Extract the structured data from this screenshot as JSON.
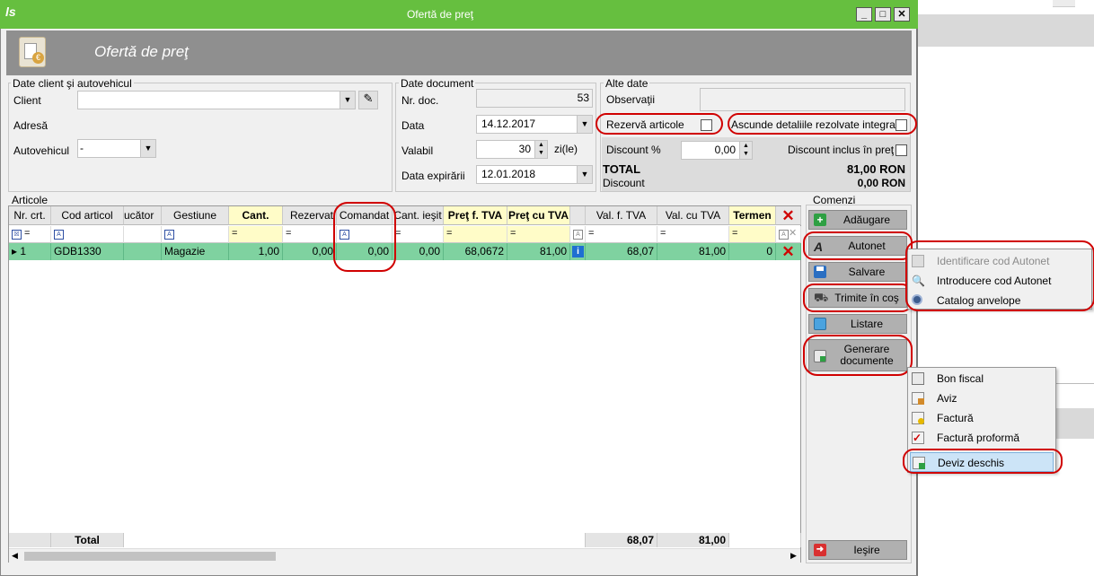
{
  "window": {
    "title": "Ofertă de preţ",
    "header_title": "Ofertă de preţ"
  },
  "client_group": {
    "label": "Date client şi autovehicul",
    "client_label": "Client",
    "client_value": "",
    "address_label": "Adresă",
    "vehicle_label": "Autovehicul",
    "vehicle_value": "-"
  },
  "doc_group": {
    "label": "Date document",
    "nr_label": "Nr. doc.",
    "nr_value": "53",
    "date_label": "Data",
    "date_value": "14.12.2017",
    "valid_label": "Valabil",
    "valid_value": "30",
    "valid_unit": "zi(le)",
    "expiry_label": "Data expirării",
    "expiry_value": "12.01.2018"
  },
  "other_group": {
    "label": "Alte date",
    "obs_label": "Observaţii",
    "reserve_label": "Rezervă articole",
    "hide_label": "Ascunde detaliile rezolvate integral",
    "discount_label": "Discount %",
    "discount_value": "0,00",
    "discount_incl_label": "Discount inclus în preţ",
    "total_label": "TOTAL",
    "total_value": "81,00 RON",
    "discount_sum_label": "Discount",
    "discount_sum_value": "0,00 RON"
  },
  "articles": {
    "label": "Articole",
    "columns": [
      "Nr. crt.",
      "Cod articol",
      "ucător",
      "Gestiune",
      "Cant.",
      "Rezervat",
      "Comandat",
      "Cant. ieşit",
      "Preţ f. TVA",
      "Preţ cu TVA",
      "Val. f. TVA",
      "Val. cu TVA",
      "Termen"
    ],
    "row": {
      "nr": "1",
      "code": "GDB1330",
      "producer": "",
      "store": "Magazie",
      "qty": "1,00",
      "reserved": "0,00",
      "ordered": "0,00",
      "out": "0,00",
      "price_net": "68,0672",
      "price_gross": "81,00",
      "val_net": "68,07",
      "val_gross": "81,00",
      "term": "0"
    },
    "total_label": "Total",
    "total_net": "68,07",
    "total_gross": "81,00"
  },
  "commands": {
    "label": "Comenzi",
    "add": "Adăugare",
    "autonet": "Autonet",
    "save": "Salvare",
    "send_cart": "Trimite în coş",
    "print": "Listare",
    "generate": "Generare documente",
    "exit": "Ieşire"
  },
  "autonet_menu": [
    "Identificare cod Autonet",
    "Introducere cod Autonet",
    "Catalog anvelope"
  ],
  "generate_menu": [
    "Bon fiscal",
    "Aviz",
    "Factură",
    "Factură proformă",
    "Deviz deschis"
  ],
  "colors": {
    "titlebar": "#66bf3f",
    "selected_row": "#7fd2a0",
    "highlight": "#d00000"
  }
}
